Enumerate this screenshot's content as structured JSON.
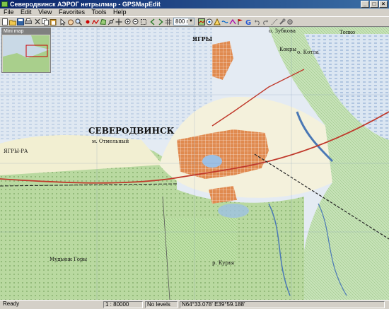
{
  "window": {
    "title": "Северодвинск АЭРОГ нетрылмар - GPSMapEdit",
    "controls": {
      "minimize": "_",
      "maximize": "□",
      "close": "×"
    }
  },
  "menu": [
    "File",
    "Edit",
    "View",
    "Favorites",
    "Tools",
    "Help"
  ],
  "toolbar": {
    "scale_value": "800 m",
    "icons": [
      "new-icon",
      "open-icon",
      "save-icon",
      "print-icon",
      "cut-icon",
      "copy-icon",
      "paste-icon",
      "select-icon",
      "hand-icon",
      "zoom-icon",
      "point-icon",
      "polyline-icon",
      "polygon-icon",
      "node-icon",
      "move-icon",
      "zoom-in-icon",
      "zoom-out-icon",
      "fit-icon",
      "back-icon",
      "forward-icon",
      "grid-icon",
      "map-icon",
      "gps-icon",
      "transform-icon",
      "google-icon",
      "undo-icon",
      "redo-icon",
      "trace-icon",
      "track-icon",
      "route-icon",
      "waypoint-icon",
      "tools-icon",
      "settings-icon"
    ]
  },
  "minimap": {
    "title": "Mini map"
  },
  "map": {
    "labels": {
      "city_main": "СЕВЕРОДВИНСК",
      "cape": "м. Отмельный",
      "yagry": "ЯГРЫ",
      "zubkov": "о. Зубкова",
      "kotla": "о. Котла",
      "kokry": "Кокры",
      "topko": "Топко",
      "tyagra": "ЯГРЫ-РА",
      "mudyug": "Мудьюж Горы",
      "lakes": "р. Курья"
    },
    "colors": {
      "water": "#dbe6f2",
      "urban": "#e08a4f",
      "forest": "#b9d9a0",
      "field": "#f2efd2",
      "road": "#c0392b"
    }
  },
  "status": {
    "state": "Ready",
    "scale": "1 : 80000",
    "levels": "No levels",
    "coords": "N64°33.078' E39°59.188'"
  }
}
